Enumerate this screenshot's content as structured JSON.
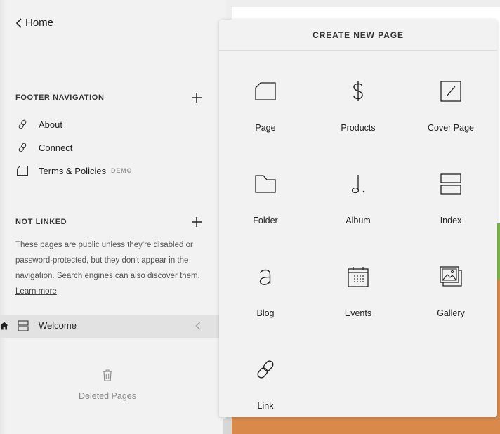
{
  "sidebar": {
    "back_label": "Home",
    "footer_nav": {
      "title": "FOOTER NAVIGATION",
      "items": [
        {
          "label": "About",
          "icon": "link-icon"
        },
        {
          "label": "Connect",
          "icon": "link-icon"
        },
        {
          "label": "Terms & Policies",
          "icon": "page-icon",
          "badge": "DEMO"
        }
      ]
    },
    "not_linked": {
      "title": "NOT LINKED",
      "note_text": "These pages are public unless they're disabled or password-protected, but they don't appear in the navigation. Search engines can also discover them. ",
      "note_link": "Learn more",
      "items": [
        {
          "label": "Welcome",
          "icon": "index-icon",
          "is_home": true
        }
      ]
    },
    "deleted_label": "Deleted Pages"
  },
  "panel": {
    "title": "CREATE NEW PAGE",
    "tiles": [
      {
        "label": "Page",
        "icon": "page-icon"
      },
      {
        "label": "Products",
        "icon": "dollar-icon"
      },
      {
        "label": "Cover Page",
        "icon": "cover-page-icon"
      },
      {
        "label": "Folder",
        "icon": "folder-icon"
      },
      {
        "label": "Album",
        "icon": "music-note-icon"
      },
      {
        "label": "Index",
        "icon": "index-icon"
      },
      {
        "label": "Blog",
        "icon": "blog-icon"
      },
      {
        "label": "Events",
        "icon": "calendar-icon"
      },
      {
        "label": "Gallery",
        "icon": "gallery-icon"
      },
      {
        "label": "Link",
        "icon": "link-icon"
      }
    ]
  },
  "colors": {
    "sidebar_bg": "#f2f2f2",
    "selected_row_bg": "#e2e2e2",
    "preview_orange": "#d98a4b",
    "preview_green": "#7cb64c"
  }
}
